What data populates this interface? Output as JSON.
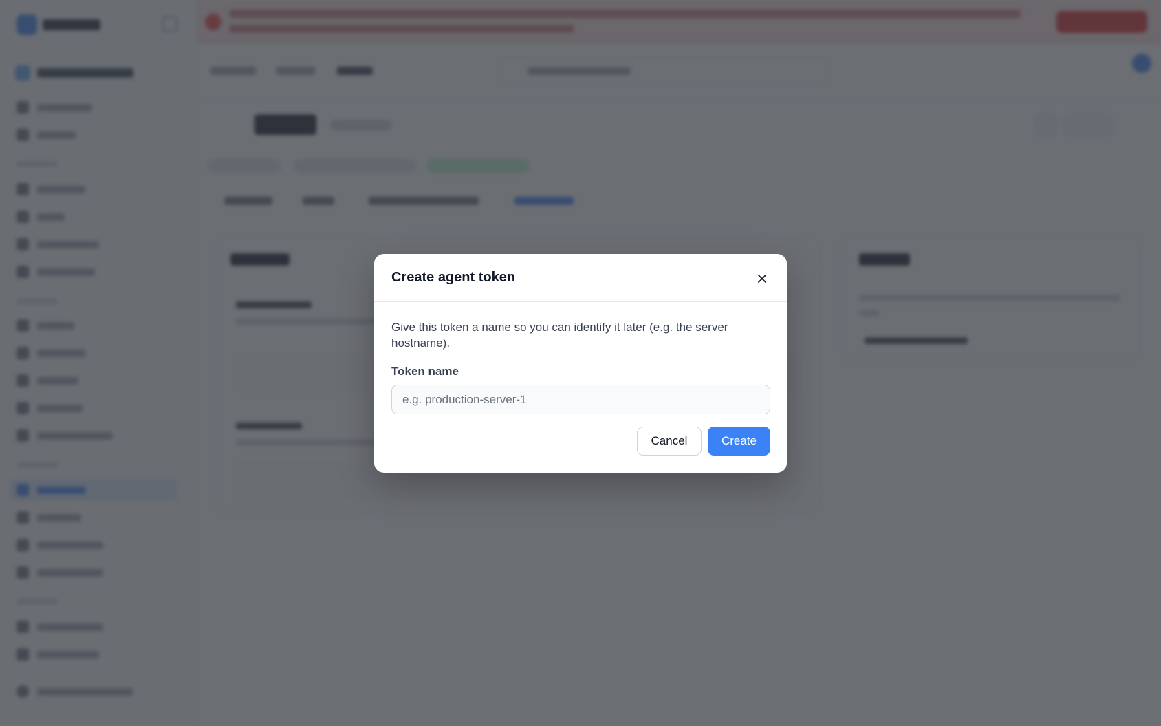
{
  "modal": {
    "title": "Create agent token",
    "close_icon": "close-icon",
    "description": "Give this token a name so you can identify it later (e.g. the server hostname).",
    "field_label": "Token name",
    "field_value": "",
    "field_placeholder": "e.g. production-server-1",
    "cancel_label": "Cancel",
    "create_label": "Create"
  },
  "colors": {
    "primary": "#3b82f6",
    "overlay": "rgba(55, 60, 66, 0.74)",
    "banner_danger": "#dc2626"
  }
}
